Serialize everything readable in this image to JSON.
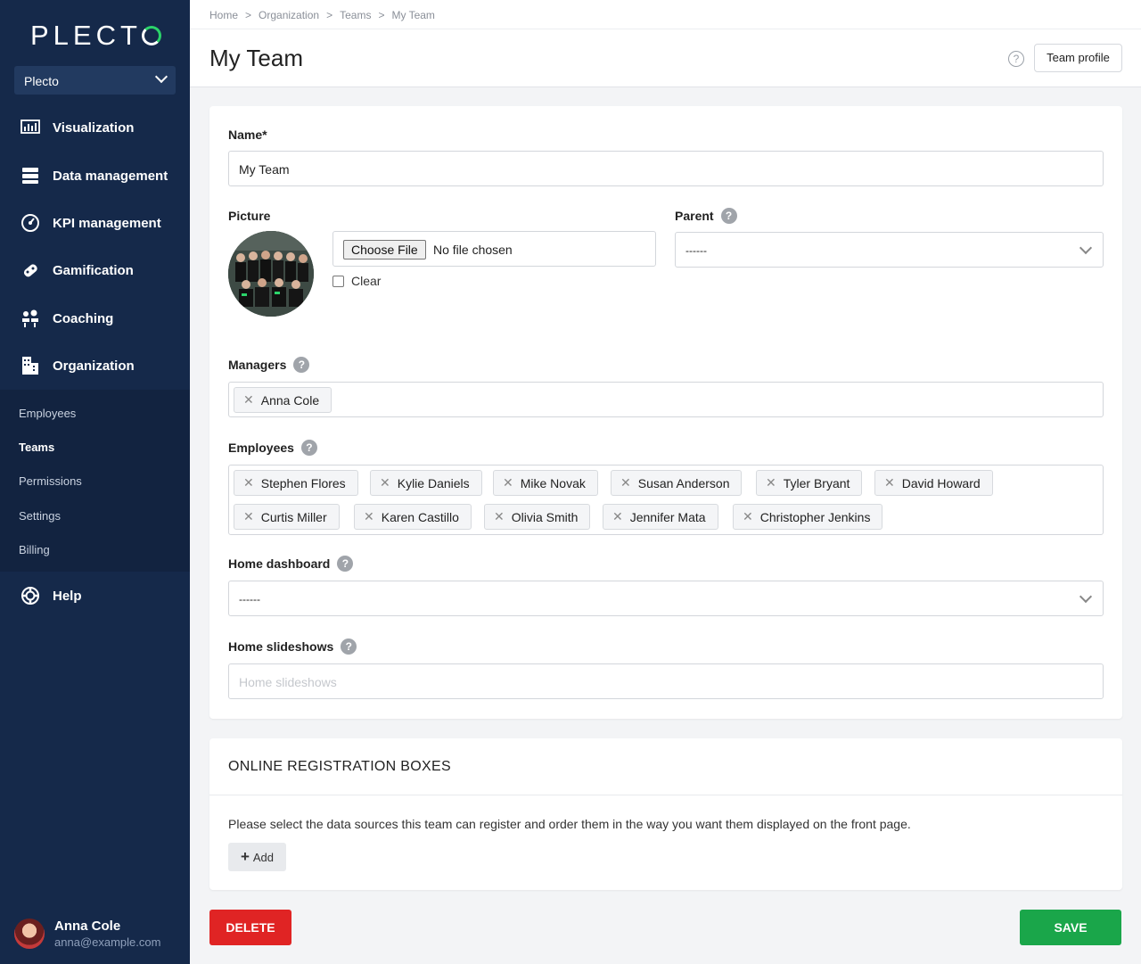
{
  "brand": {
    "logo_text_start": "PLECT",
    "accent_color": "#2bd46a",
    "sidebar_color": "#15294a"
  },
  "sidebar": {
    "org_select": "Plecto",
    "items": [
      {
        "label": "Visualization",
        "icon": "bar-chart-icon"
      },
      {
        "label": "Data management",
        "icon": "database-icon"
      },
      {
        "label": "KPI management",
        "icon": "gauge-icon"
      },
      {
        "label": "Gamification",
        "icon": "gamepad-icon"
      },
      {
        "label": "Coaching",
        "icon": "coaching-icon"
      },
      {
        "label": "Organization",
        "icon": "building-icon"
      }
    ],
    "subitems": [
      {
        "label": "Employees"
      },
      {
        "label": "Teams"
      },
      {
        "label": "Permissions"
      },
      {
        "label": "Settings"
      },
      {
        "label": "Billing"
      }
    ],
    "help": {
      "label": "Help",
      "icon": "lifebuoy-icon"
    },
    "user": {
      "name": "Anna Cole",
      "email": "anna@example.com"
    }
  },
  "breadcrumb": [
    "Home",
    "Organization",
    "Teams",
    "My Team"
  ],
  "breadcrumb_separator": ">",
  "page": {
    "title": "My Team",
    "team_profile_label": "Team profile",
    "help_icon": "?"
  },
  "form": {
    "name": {
      "label": "Name*",
      "value": "My Team"
    },
    "picture": {
      "label": "Picture",
      "choose_file_label": "Choose File",
      "no_file_text": "No file chosen",
      "clear_label": "Clear"
    },
    "parent": {
      "label": "Parent",
      "value": "------"
    },
    "managers": {
      "label": "Managers",
      "tags": [
        "Anna Cole"
      ]
    },
    "employees": {
      "label": "Employees",
      "tags": [
        "Stephen Flores",
        "Kylie Daniels",
        "Mike Novak",
        "Susan Anderson",
        "Tyler Bryant",
        "David Howard",
        "Curtis Miller",
        "Karen Castillo",
        "Olivia Smith",
        "Jennifer Mata",
        "Christopher Jenkins"
      ]
    },
    "home_dashboard": {
      "label": "Home dashboard",
      "value": "------"
    },
    "home_slideshows": {
      "label": "Home slideshows",
      "placeholder": "Home slideshows"
    }
  },
  "registration": {
    "title": "ONLINE REGISTRATION BOXES",
    "description": "Please select the data sources this team can register and order them in the way you want them displayed on the front page.",
    "add_label": "Add"
  },
  "actions": {
    "delete_label": "DELETE",
    "save_label": "SAVE",
    "delete_color": "#e02424",
    "save_color": "#1aa64a"
  },
  "tag_remove_glyph": "✕"
}
